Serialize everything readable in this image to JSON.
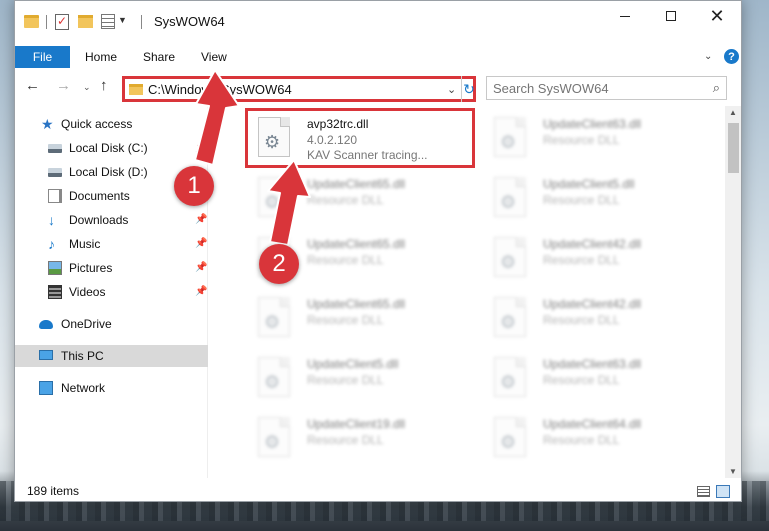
{
  "window": {
    "title": "SysWOW64",
    "minimize_icon": "minimize-icon",
    "maximize_icon": "maximize-icon",
    "close_glyph": "✕"
  },
  "ribbon": {
    "file": "File",
    "home": "Home",
    "share": "Share",
    "view": "View",
    "help": "?"
  },
  "address": {
    "path": "C:\\Windows\\SysWOW64",
    "search_placeholder": "Search SysWOW64"
  },
  "sidebar": {
    "items": [
      {
        "label": "Quick access",
        "icon": "star-icon"
      },
      {
        "label": "Local Disk (C:)",
        "icon": "drive-icon"
      },
      {
        "label": "Local Disk (D:)",
        "icon": "drive-icon"
      },
      {
        "label": "Documents",
        "icon": "documents-icon"
      },
      {
        "label": "Downloads",
        "icon": "download-icon"
      },
      {
        "label": "Music",
        "icon": "music-icon"
      },
      {
        "label": "Pictures",
        "icon": "pictures-icon"
      },
      {
        "label": "Videos",
        "icon": "videos-icon"
      },
      {
        "label": "OneDrive",
        "icon": "onedrive-icon"
      },
      {
        "label": "This PC",
        "icon": "pc-icon"
      },
      {
        "label": "Network",
        "icon": "network-icon"
      }
    ]
  },
  "files": {
    "highlighted": {
      "name": "avp32trc.dll",
      "version": "4.0.2.120",
      "description": "KAV Scanner tracing..."
    },
    "left": [
      {
        "name": "UpdateClient65.dll",
        "type": "Resource DLL"
      },
      {
        "name": "UpdateClient65.dll",
        "type": "Resource DLL"
      },
      {
        "name": "UpdateClient65.dll",
        "type": "Resource DLL"
      },
      {
        "name": "UpdateClient5.dll",
        "type": "Resource DLL"
      },
      {
        "name": "UpdateClient19.dll",
        "type": "Resource DLL"
      }
    ],
    "right": [
      {
        "name": "UpdateClient63.dll",
        "type": "Resource DLL"
      },
      {
        "name": "UpdateClient5.dll",
        "type": "Resource DLL"
      },
      {
        "name": "UpdateClient42.dll",
        "type": "Resource DLL"
      },
      {
        "name": "UpdateClient42.dll",
        "type": "Resource DLL"
      },
      {
        "name": "UpdateClient63.dll",
        "type": "Resource DLL"
      },
      {
        "name": "UpdateClient64.dll",
        "type": "Resource DLL"
      }
    ]
  },
  "status": {
    "items": "189 items"
  },
  "annotations": {
    "badge1": "1",
    "badge2": "2",
    "color": "#d9353a"
  }
}
